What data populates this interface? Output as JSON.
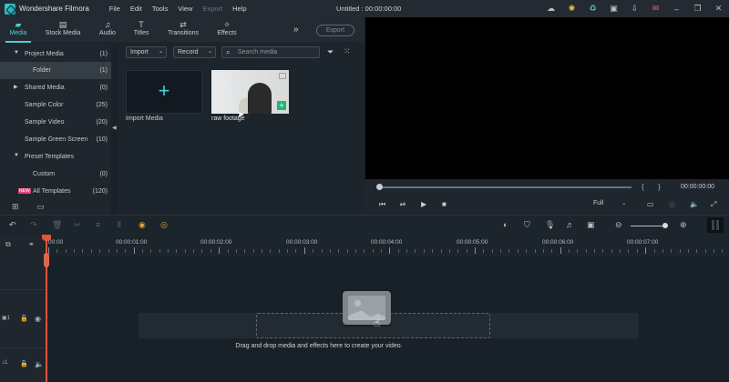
{
  "titlebar": {
    "app_name": "Wondershare Filmora",
    "menus": [
      {
        "label": "File",
        "enabled": true
      },
      {
        "label": "Edit",
        "enabled": true
      },
      {
        "label": "Tools",
        "enabled": true
      },
      {
        "label": "View",
        "enabled": true
      },
      {
        "label": "Export",
        "enabled": false
      },
      {
        "label": "Help",
        "enabled": true
      }
    ],
    "window_title": "Untitled : 00:00:00:00"
  },
  "tabs": [
    {
      "label": "Media",
      "icon": "folder-icon",
      "active": true
    },
    {
      "label": "Stock Media",
      "icon": "stock-media-icon",
      "active": false
    },
    {
      "label": "Audio",
      "icon": "music-note-icon",
      "active": false
    },
    {
      "label": "Titles",
      "icon": "titles-icon",
      "active": false
    },
    {
      "label": "Transitions",
      "icon": "transitions-icon",
      "active": false
    },
    {
      "label": "Effects",
      "icon": "effects-icon",
      "active": false
    }
  ],
  "export_label": "Export",
  "sidebar": {
    "items": [
      {
        "label": "Project Media",
        "count": "(1)",
        "expanded": true
      },
      {
        "label": "Folder",
        "count": "(1)",
        "selected": true
      },
      {
        "label": "Shared Media",
        "count": "(0)",
        "expanded": false
      },
      {
        "label": "Sample Color",
        "count": "(25)"
      },
      {
        "label": "Sample Video",
        "count": "(20)"
      },
      {
        "label": "Sample Green Screen",
        "count": "(10)"
      },
      {
        "label": "Preset Templates",
        "count": "",
        "expanded": true
      },
      {
        "label": "Custom",
        "count": "(0)"
      },
      {
        "label": "All Templates",
        "count": "(120)",
        "badge": "NEW"
      }
    ]
  },
  "media": {
    "import_dropdown": "Import",
    "record_dropdown": "Record",
    "search_placeholder": "Search media",
    "import_tile_label": "Import Media",
    "clip_label": "raw footage"
  },
  "preview": {
    "time": "00:00:00:00",
    "quality": "Full"
  },
  "timeline": {
    "ruler_labels": [
      "00:00",
      "00:00:01:00",
      "00:00:02:00",
      "00:00:03:00",
      "00:00:04:00",
      "00:00:05:00",
      "00:00:06:00",
      "00:00:07:00"
    ],
    "video_track": "1",
    "audio_track": "1",
    "drop_hint": "Drag and drop media and effects here to create your video."
  }
}
